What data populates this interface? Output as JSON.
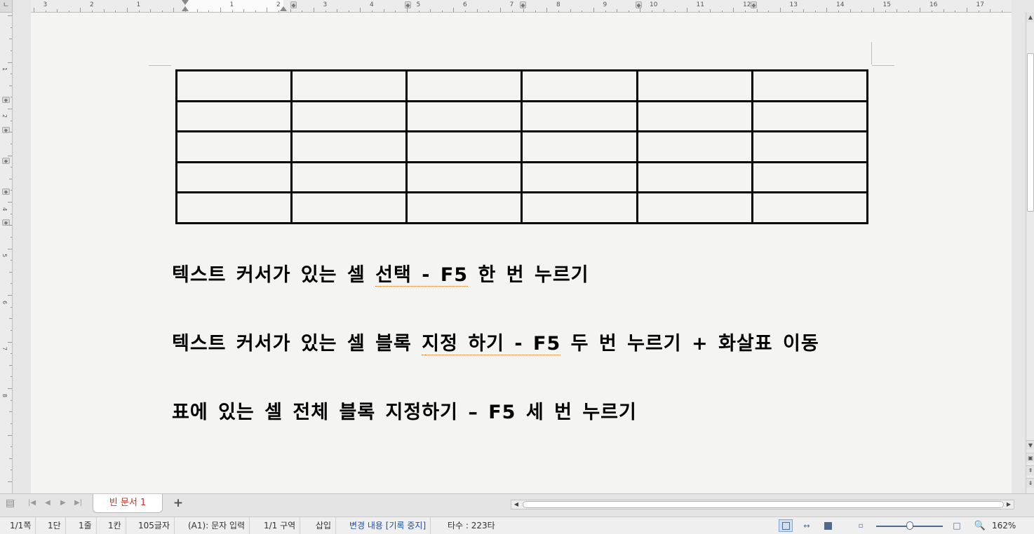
{
  "ruler": {
    "corner_label": "ㄴ",
    "h_numbers": [
      "3",
      "2",
      "1",
      "1",
      "2",
      "3",
      "4",
      "5",
      "6",
      "7",
      "8",
      "9",
      "10",
      "11",
      "12",
      "13",
      "14",
      "15",
      "16",
      "17"
    ],
    "v_numbers": [
      "1",
      "2",
      "3",
      "4",
      "5",
      "6",
      "7",
      "8"
    ]
  },
  "document": {
    "table": {
      "rows": 5,
      "cols": 6
    },
    "lines": [
      {
        "pre": "텍스트 커서가 있는 셀 ",
        "marked": "선택 -  F5",
        "post": " 한 번 누르기"
      },
      {
        "pre": "텍스트 커서가 있는 셀 블록 ",
        "marked": "지정 하기  - F5",
        "post": " 두 번 누르기 + 화살표 이동"
      },
      {
        "pre": "표에 있는 셀 전체 블록 지정하기 – F5 세 번 누르기",
        "marked": "",
        "post": ""
      }
    ]
  },
  "tabs": {
    "active": "빈 문서 1",
    "add": "+"
  },
  "status": {
    "page": "1/1쪽",
    "column": "1단",
    "line": "1줄",
    "cell": "1칸",
    "chars": "105글자",
    "mode": "(A1): 문자 입력",
    "section": "1/1 구역",
    "insert": "삽입",
    "track_changes": "변경 내용 [기록 중지]",
    "keystrokes": "타수 : 223타",
    "zoom": "162%",
    "zoom_fraction": 0.5
  },
  "colors": {
    "tab_text": "#c0392b",
    "status_blue": "#1f4fa8",
    "page_bg": "#f4f4f2"
  }
}
